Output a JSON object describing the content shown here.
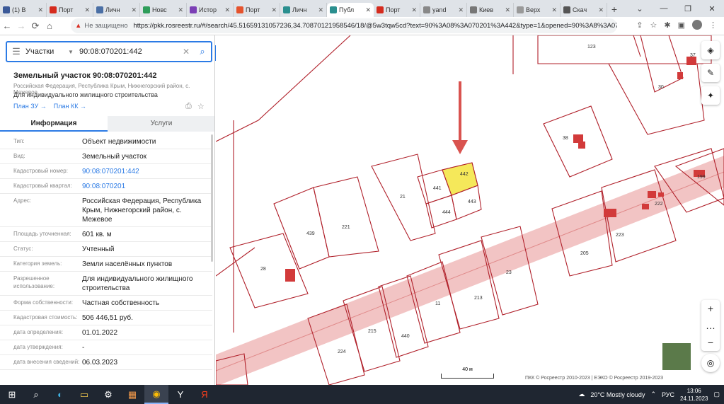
{
  "browser": {
    "tabs": [
      {
        "label": "(1) В",
        "color": "#3b5998"
      },
      {
        "label": "Порт",
        "color": "#d52b1e"
      },
      {
        "label": "Личн",
        "color": "#4a6fa5"
      },
      {
        "label": "Новс",
        "color": "#2e9d5a"
      },
      {
        "label": "Истор",
        "color": "#7b3fb5"
      },
      {
        "label": "Порт",
        "color": "#e5532d"
      },
      {
        "label": "Личн",
        "color": "#2a8f8f"
      },
      {
        "label": "Публ",
        "color": "#2a8f8f"
      },
      {
        "label": "Порт",
        "color": "#d52b1e"
      },
      {
        "label": "yand",
        "color": "#888888"
      },
      {
        "label": "Киев",
        "color": "#777777"
      },
      {
        "label": "Верх",
        "color": "#999999"
      },
      {
        "label": "Скач",
        "color": "#555555"
      }
    ],
    "active_tab_index": 7,
    "new_tab": "+",
    "window_controls": [
      "⌄",
      "—",
      "❐",
      "✕"
    ],
    "not_secure": "Не защищено",
    "url": "https://pkk.rosreestr.ru/#/search/45.51659131057236,34.70870121958546/18/@5w3tqw5cd?text=90%3A08%3A070201%3A442&type=1&opened=90%3A8%3A070201..."
  },
  "search": {
    "type": "Участки",
    "value": "90:08:070201:442"
  },
  "parcel": {
    "title": "Земельный участок 90:08:070201:442",
    "address_line": "Российская Федерация, Республика Крым, Нижнегорский район, с. Межевое",
    "purpose": "Для индивидуального жилищного строительства",
    "link_plan_zu": "План ЗУ →",
    "link_plan_kk": "План КК →"
  },
  "info_tabs": [
    "Информация",
    "Услуги"
  ],
  "info_rows": [
    {
      "key": "Тип:",
      "value": "Объект недвижимости",
      "link": false
    },
    {
      "key": "Вид:",
      "value": "Земельный участок",
      "link": false
    },
    {
      "key": "Кадастровый номер:",
      "value": "90:08:070201:442",
      "link": true
    },
    {
      "key": "Кадастровый квартал:",
      "value": "90:08:070201",
      "link": true
    },
    {
      "key": "Адрес:",
      "value": "Российская Федерация, Республика Крым, Нижнегорский район, с. Межевое",
      "link": false
    },
    {
      "key": "Площадь уточненная:",
      "value": "601 кв. м",
      "link": false
    },
    {
      "key": "Статус:",
      "value": "Учтенный",
      "link": false
    },
    {
      "key": "Категория земель:",
      "value": "Земли населённых пунктов",
      "link": false
    },
    {
      "key": "Разрешенное использование:",
      "value": "Для индивидуального жилищного строительства",
      "link": false
    },
    {
      "key": "Форма собственности:",
      "value": "Частная собственность",
      "link": false
    },
    {
      "key": "Кадастровая стоимость:",
      "value": "506 446,51 руб.",
      "link": false
    },
    {
      "key": "дата определения:",
      "value": "01.01.2022",
      "link": false
    },
    {
      "key": "дата утверждения:",
      "value": "-",
      "link": false
    },
    {
      "key": "дата внесения сведений:",
      "value": "06.03.2023",
      "link": false
    }
  ],
  "map": {
    "parcel_labels": [
      "123",
      "37",
      "30",
      "38",
      "442",
      "441",
      "21",
      "444",
      "443",
      "199",
      "222",
      "439",
      "221",
      "28",
      "223",
      "205",
      "23",
      "11",
      "213",
      "215",
      "440",
      "224"
    ],
    "scale_label": "40 м",
    "copyright": "ПКК © Росреестр 2010-2023 | ЕЭКО © Росреестр 2019-2023",
    "highlight_color": "#f5e85a",
    "road_color": "#f2b9b9",
    "boundary_color": "#b0202a",
    "arrow_color": "#d9534f"
  },
  "taskbar": {
    "weather": "20°C  Mostly cloudy",
    "lang": "РУС",
    "time": "13:06",
    "date": "24.11.2023"
  }
}
